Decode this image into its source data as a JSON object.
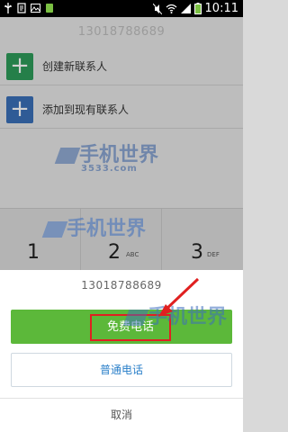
{
  "status_bar": {
    "time": "10:11",
    "left_icons": [
      "usb-icon",
      "file-icon",
      "image-icon",
      "battery-app-icon"
    ],
    "right_icons": [
      "silent-icon",
      "wifi-icon",
      "signal-icon",
      "battery-icon"
    ]
  },
  "background": {
    "dialed_number": "13018788689",
    "actions": [
      {
        "label": "创建新联系人",
        "color": "#2e9b5a"
      },
      {
        "label": "添加到现有联系人",
        "color": "#3a6fb8"
      }
    ],
    "keys": [
      {
        "digit": "1",
        "letters": ""
      },
      {
        "digit": "2",
        "letters": "ABC"
      },
      {
        "digit": "3",
        "letters": "DEF"
      }
    ]
  },
  "watermark": {
    "brand": "手机世界",
    "site": "3533.com"
  },
  "sheet": {
    "number": "13018788689",
    "free_call_label": "免费电话",
    "normal_call_label": "普通电话",
    "cancel_label": "取消"
  },
  "colors": {
    "free_call_green": "#5cb83a",
    "normal_call_blue": "#2a7fc9",
    "highlight_red": "#e02020"
  }
}
